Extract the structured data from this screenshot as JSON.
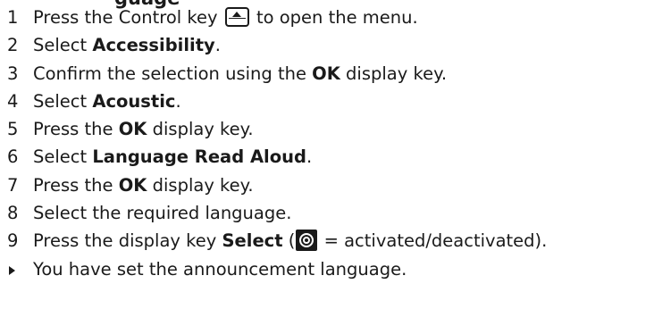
{
  "heading_fragment": "guage",
  "steps": [
    {
      "num": "1",
      "pre": "Press the Control key",
      "post": "to open the menu."
    },
    {
      "num": "2",
      "pre": "Select ",
      "bold": "Accessibility",
      "post": "."
    },
    {
      "num": "3",
      "pre": "Confirm the selection using the ",
      "bold": "OK",
      "post": " display key."
    },
    {
      "num": "4",
      "pre": "Select ",
      "bold": "Acoustic",
      "post": "."
    },
    {
      "num": "5",
      "pre": "Press the ",
      "bold": "OK",
      "post": " display key."
    },
    {
      "num": "6",
      "pre": "Select ",
      "bold": "Language Read Aloud",
      "post": "."
    },
    {
      "num": "7",
      "pre": "Press the ",
      "bold": "OK",
      "post": " display key."
    },
    {
      "num": "8",
      "pre": "Select the required language."
    },
    {
      "num": "9",
      "pre": "Press the display key ",
      "bold": "Select",
      "mid": " (",
      "post": " = activated/deactivated)."
    }
  ],
  "result": "You have set the announcement language.",
  "icons": {
    "control_key": "control-key-icon",
    "radio": "radio-selected-icon",
    "result": "result-arrow-icon"
  }
}
